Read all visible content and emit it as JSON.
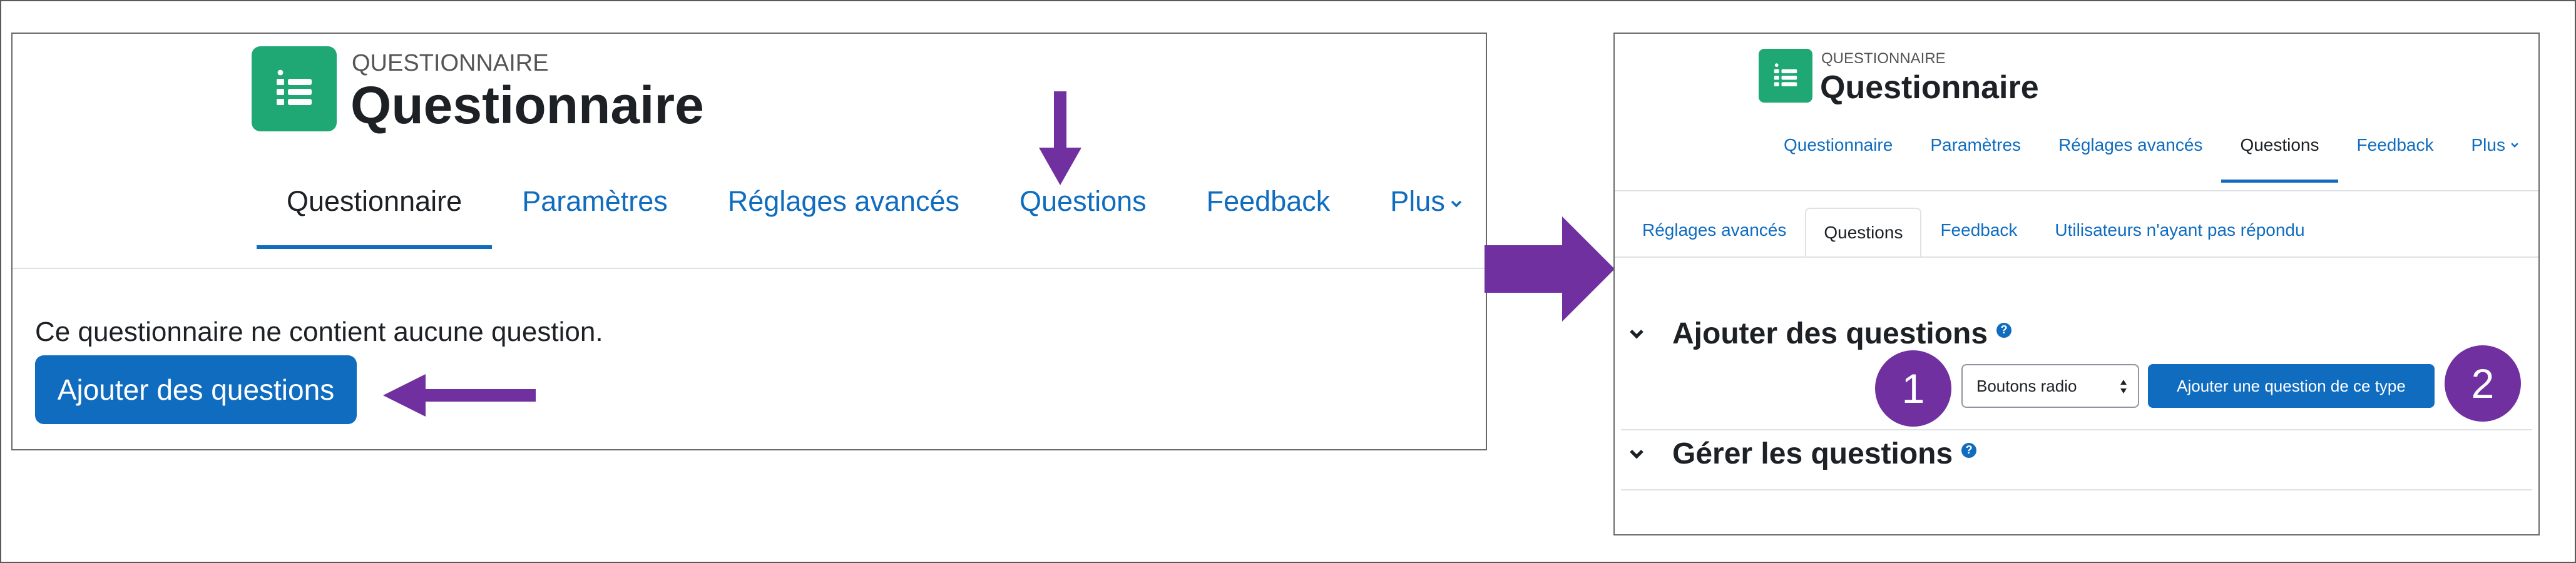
{
  "accent_color": "#0f6cbf",
  "annotation_color": "#7030a0",
  "activity_icon_color": "#1fa774",
  "left_panel": {
    "eyebrow": "QUESTIONNAIRE",
    "title": "Questionnaire",
    "nav_tabs": [
      {
        "label": "Questionnaire",
        "active": true
      },
      {
        "label": "Paramètres",
        "active": false
      },
      {
        "label": "Réglages avancés",
        "active": false
      },
      {
        "label": "Questions",
        "active": false
      },
      {
        "label": "Feedback",
        "active": false
      },
      {
        "label": "Plus",
        "active": false
      }
    ],
    "empty_message": "Ce questionnaire ne contient aucune question.",
    "add_button": "Ajouter des questions"
  },
  "right_panel": {
    "eyebrow": "QUESTIONNAIRE",
    "title": "Questionnaire",
    "nav_tabs": [
      {
        "label": "Questionnaire",
        "active": false
      },
      {
        "label": "Paramètres",
        "active": false
      },
      {
        "label": "Réglages avancés",
        "active": false
      },
      {
        "label": "Questions",
        "active": true
      },
      {
        "label": "Feedback",
        "active": false
      },
      {
        "label": "Plus",
        "active": false
      }
    ],
    "sub_tabs": [
      {
        "label": "Réglages avancés",
        "active": false
      },
      {
        "label": "Questions",
        "active": true
      },
      {
        "label": "Feedback",
        "active": false
      },
      {
        "label": "Utilisateurs n'ayant pas répondu",
        "active": false
      }
    ],
    "section_add": "Ajouter des questions",
    "question_type_selected": "Boutons radio",
    "add_type_button": "Ajouter une question de ce type",
    "section_manage": "Gérer les questions"
  },
  "annotations": {
    "step1": "1",
    "step2": "2"
  },
  "icons": [
    "questionnaire-icon",
    "chevron-down-icon",
    "help-icon",
    "select-arrows-icon",
    "arrow-down",
    "arrow-left",
    "arrow-right"
  ]
}
